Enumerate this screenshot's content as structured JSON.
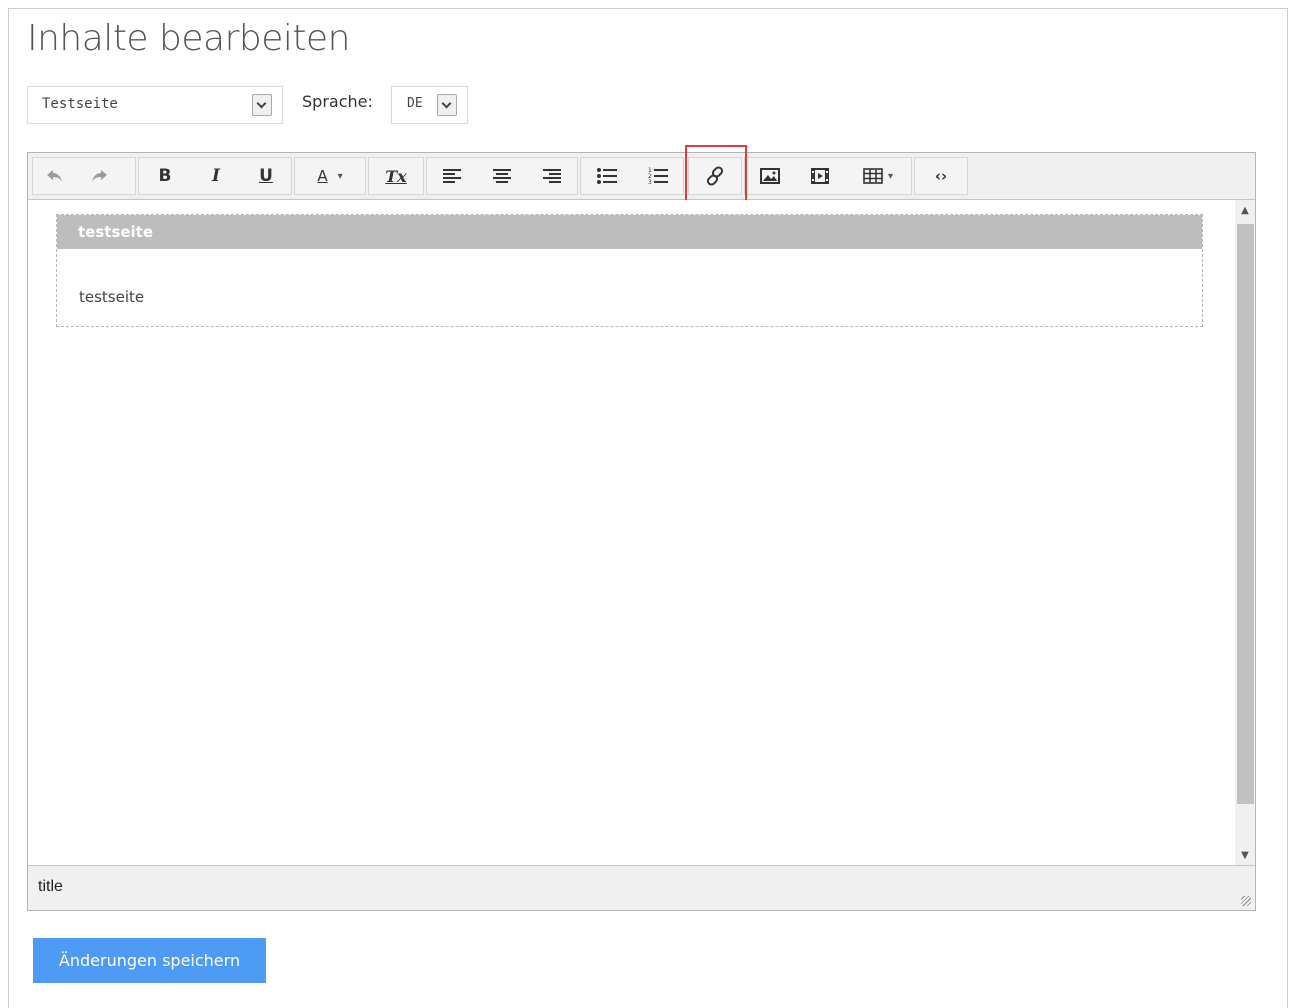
{
  "page": {
    "title": "Inhalte bearbeiten"
  },
  "page_select": {
    "value": "Testseite"
  },
  "language": {
    "label": "Sprache:",
    "value": "DE"
  },
  "toolbar": {
    "undo": "↶",
    "redo": "↷",
    "bold": "B",
    "italic": "I",
    "underline": "U",
    "text_color": "A",
    "dropdown_caret": "▾",
    "clear_format": "Tx",
    "align_left": "≡",
    "align_center": "≡",
    "align_right": "≡",
    "bullet_list": "☰",
    "numbered_list": "☰",
    "link": "🔗",
    "image": "▣",
    "media": "▦",
    "table": "⊞",
    "code": "‹›"
  },
  "editor": {
    "block_title": "testseite",
    "block_text": "testseite",
    "status_path": "title"
  },
  "actions": {
    "save_label": "Änderungen speichern"
  },
  "colors": {
    "accent": "#4d9bf5",
    "highlight": "#e53935"
  }
}
